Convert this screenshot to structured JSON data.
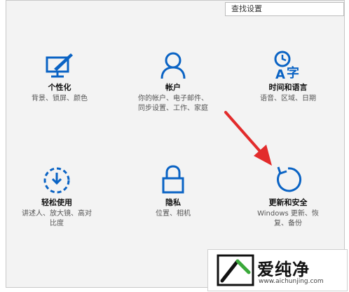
{
  "search": {
    "placeholder": "查找设置"
  },
  "tiles": [
    {
      "title": "个性化",
      "desc": [
        "背景、锁屏、颜色"
      ],
      "icon": "personalization-icon"
    },
    {
      "title": "帐户",
      "desc": [
        "你的帐户、电子邮件、",
        "同步设置、工作、家庭"
      ],
      "icon": "account-icon"
    },
    {
      "title": "时间和语言",
      "desc": [
        "语音、区域、日期"
      ],
      "icon": "time-language-icon"
    },
    {
      "title": "轻松使用",
      "desc": [
        "讲述人、放大镜、高对",
        "比度"
      ],
      "icon": "ease-of-access-icon"
    },
    {
      "title": "隐私",
      "desc": [
        "位置、相机"
      ],
      "icon": "privacy-lock-icon"
    },
    {
      "title": "更新和安全",
      "desc": [
        "Windows 更新、恢",
        "复、备份"
      ],
      "icon": "update-security-icon"
    }
  ],
  "watermark": {
    "text": "爱纯净",
    "url": "www.aichunjing.com"
  },
  "colors": {
    "accent": "#0a63c4",
    "arrow": "#e22b2b"
  }
}
